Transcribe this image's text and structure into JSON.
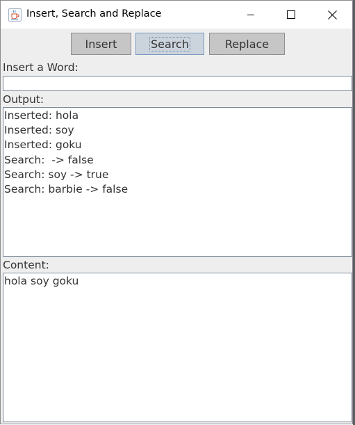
{
  "window": {
    "title": "Insert, Search and Replace",
    "app_icon": "java-cup-icon"
  },
  "toolbar": {
    "insert_label": "Insert",
    "search_label": "Search",
    "replace_label": "Replace",
    "focused_button": "Search"
  },
  "insert_section": {
    "label": "Insert a Word:",
    "value": ""
  },
  "output_section": {
    "label": "Output:",
    "lines": [
      "Inserted: hola",
      "Inserted: soy",
      "Inserted: goku",
      "Search:  -> false",
      "Search: soy -> true",
      "Search: barbie -> false"
    ]
  },
  "content_section": {
    "label": "Content:",
    "lines": [
      "hola soy goku"
    ]
  },
  "colors": {
    "window_bg": "#eeeeee",
    "button_bg": "#c6c6c6",
    "focused_button_bg": "#cbd3dd",
    "field_border": "#7f8c9d"
  }
}
